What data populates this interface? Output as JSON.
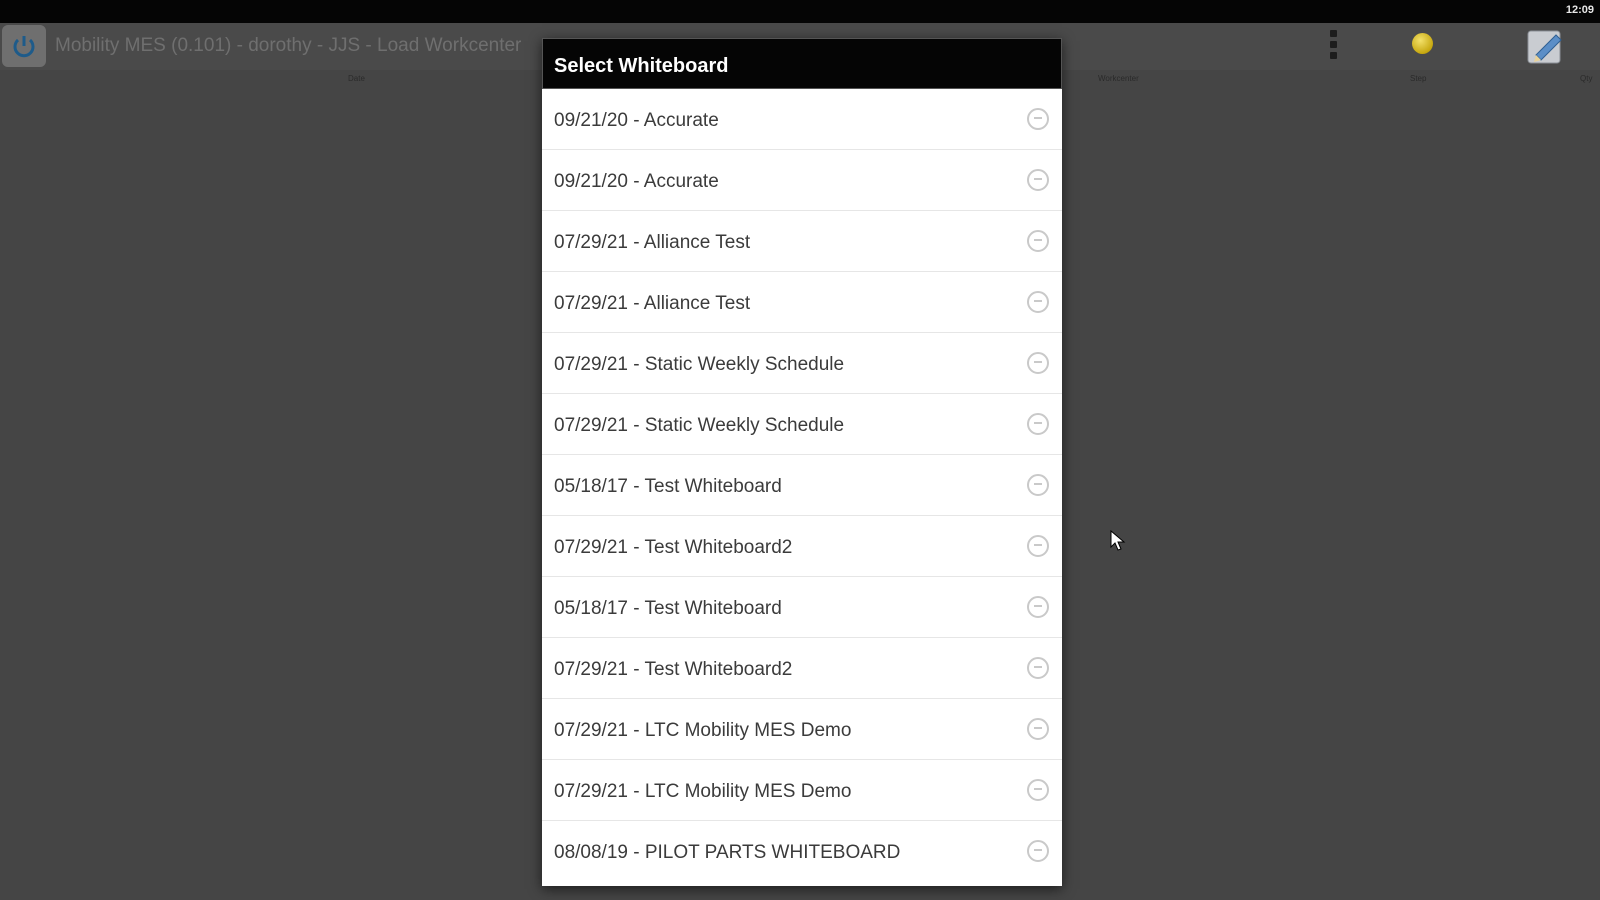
{
  "statusbar": {
    "clock": "12:09"
  },
  "appbar": {
    "title": "Mobility MES (0.101) - dorothy - JJS - Load Workcenter",
    "app_icon": "power-sync-icon",
    "overflow_icon": "overflow-menu-icon",
    "status_icon": "status-dot-icon",
    "edit_icon": "edit-pencil-icon"
  },
  "columns": {
    "date": "Date",
    "workcenter": "Workcenter",
    "step": "Step",
    "qty": "Qty"
  },
  "dialog": {
    "title": "Select Whiteboard",
    "items": [
      {
        "label": "09/21/20 - Accurate"
      },
      {
        "label": "09/21/20 - Accurate"
      },
      {
        "label": "07/29/21 - Alliance Test"
      },
      {
        "label": "07/29/21 - Alliance Test"
      },
      {
        "label": "07/29/21 - Static Weekly Schedule"
      },
      {
        "label": "07/29/21 - Static Weekly Schedule"
      },
      {
        "label": "05/18/17 - Test Whiteboard"
      },
      {
        "label": "07/29/21 - Test Whiteboard2"
      },
      {
        "label": "05/18/17 - Test Whiteboard"
      },
      {
        "label": "07/29/21 - Test Whiteboard2"
      },
      {
        "label": "07/29/21 - LTC Mobility MES Demo"
      },
      {
        "label": "07/29/21 - LTC Mobility MES Demo"
      },
      {
        "label": "08/08/19 - PILOT PARTS WHITEBOARD"
      }
    ]
  },
  "colors": {
    "background": "#454545",
    "dialog_header": "#050505",
    "accent_status": "#d4b515"
  }
}
